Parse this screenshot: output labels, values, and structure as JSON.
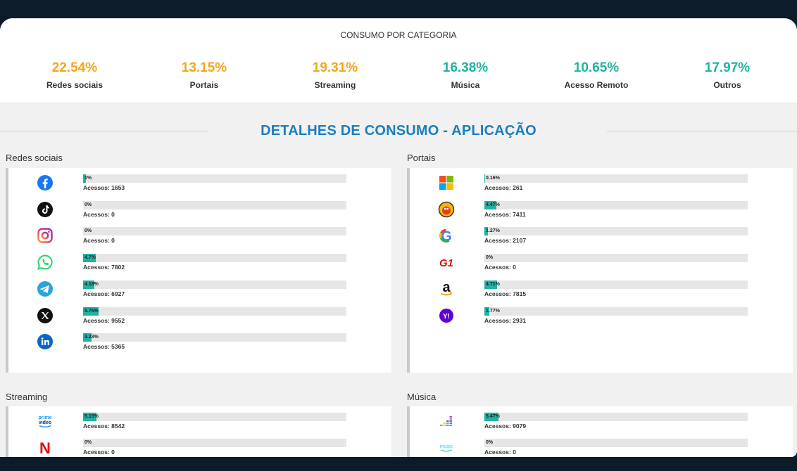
{
  "summary": {
    "title": "CONSUMO POR CATEGORIA",
    "kpis": [
      {
        "value": "22.54%",
        "label": "Redes sociais",
        "color": "#f2a71b"
      },
      {
        "value": "13.15%",
        "label": "Portais",
        "color": "#f2a71b"
      },
      {
        "value": "19.31%",
        "label": "Streaming",
        "color": "#f2a71b"
      },
      {
        "value": "16.38%",
        "label": "Música",
        "color": "#1fb3a4"
      },
      {
        "value": "10.65%",
        "label": "Acesso Remoto",
        "color": "#1fb3a4"
      },
      {
        "value": "17.97%",
        "label": "Outros",
        "color": "#1fb3a4"
      }
    ]
  },
  "details": {
    "title": "DETALHES DE CONSUMO - APLICAÇÃO",
    "sections": {
      "redes": {
        "label": "Redes sociais",
        "apps": [
          {
            "icon": "facebook-icon",
            "pct": "1%",
            "fraction": 0.01,
            "accesses": "Acessos: 1653"
          },
          {
            "icon": "tiktok-icon",
            "pct": "0%",
            "fraction": 0,
            "accesses": "Acessos: 0"
          },
          {
            "icon": "instagram-icon",
            "pct": "0%",
            "fraction": 0,
            "accesses": "Acessos: 0"
          },
          {
            "icon": "whatsapp-icon",
            "pct": "4.7%",
            "fraction": 0.047,
            "accesses": "Acessos: 7802"
          },
          {
            "icon": "telegram-icon",
            "pct": "4.18%",
            "fraction": 0.0418,
            "accesses": "Acessos: 6927"
          },
          {
            "icon": "x-icon",
            "pct": "5.76%",
            "fraction": 0.0576,
            "accesses": "Acessos: 9552"
          },
          {
            "icon": "linkedin-icon",
            "pct": "3.23%",
            "fraction": 0.0323,
            "accesses": "Acessos: 5365"
          }
        ]
      },
      "portais": {
        "label": "Portais",
        "apps": [
          {
            "icon": "microsoft-icon",
            "pct": "0.16%",
            "fraction": 0.0016,
            "accesses": "Acessos: 261"
          },
          {
            "icon": "uol-icon",
            "pct": "4.47%",
            "fraction": 0.0447,
            "accesses": "Acessos: 7411"
          },
          {
            "icon": "google-icon",
            "pct": "1.27%",
            "fraction": 0.0127,
            "accesses": "Acessos: 2107"
          },
          {
            "icon": "g1-icon",
            "pct": "0%",
            "fraction": 0,
            "accesses": "Acessos: 0"
          },
          {
            "icon": "amazon-icon",
            "pct": "4.71%",
            "fraction": 0.0471,
            "accesses": "Acessos: 7815"
          },
          {
            "icon": "yahoo-icon",
            "pct": "1.77%",
            "fraction": 0.0177,
            "accesses": "Acessos: 2931"
          }
        ]
      },
      "streaming": {
        "label": "Streaming",
        "apps": [
          {
            "icon": "prime-video-icon",
            "pct": "5.15%",
            "fraction": 0.0515,
            "accesses": "Acessos: 8542"
          },
          {
            "icon": "netflix-icon",
            "pct": "0%",
            "fraction": 0,
            "accesses": "Acessos: 0"
          }
        ]
      },
      "musica": {
        "label": "Música",
        "apps": [
          {
            "icon": "deezer-icon",
            "pct": "5.47%",
            "fraction": 0.0547,
            "accesses": "Acessos: 9079"
          },
          {
            "icon": "amazon-music-icon",
            "pct": "0%",
            "fraction": 0,
            "accesses": "Acessos: 0"
          }
        ]
      }
    }
  },
  "icon_texts": {
    "prime_top": "prime",
    "prime_bottom": "video",
    "g1": "G1",
    "amazon": "a",
    "yahoo": "Y!",
    "netflix": "N",
    "music": "music",
    "google": "G"
  }
}
